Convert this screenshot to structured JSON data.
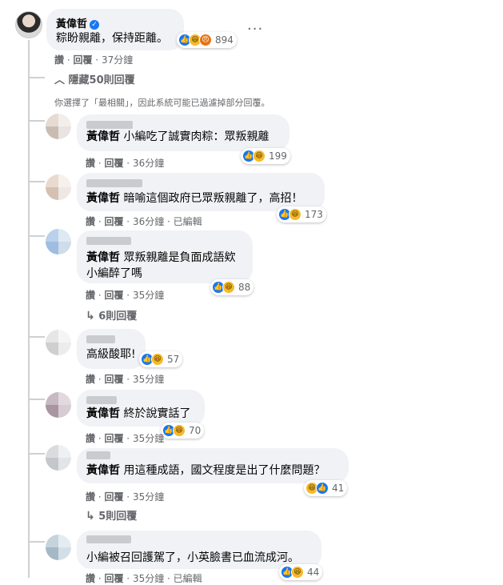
{
  "main_comment": {
    "author": "黃偉哲",
    "verified_icon": "verified-badge-icon",
    "text": "粽盼親離，保持距離。",
    "reaction_count": "894",
    "actions": {
      "like": "讚",
      "reply": "回覆",
      "time": "37分鐘"
    },
    "more_icon": "···"
  },
  "hide_replies_label": "隱藏50則回覆",
  "filter_notice": "你選擇了「最相關」，因此系統可能已過濾掉部分回覆。",
  "replies": [
    {
      "tag": "黃偉哲",
      "text": "小編吃了誠實肉粽：眾叛親離",
      "reaction_count": "199",
      "like": "讚",
      "reply": "回覆",
      "time": "36分鐘",
      "edited": ""
    },
    {
      "tag": "黃偉哲",
      "text": "暗喻這個政府已眾叛親離了，高招！",
      "reaction_count": "173",
      "like": "讚",
      "reply": "回覆",
      "time": "36分鐘",
      "edited": "已編輯"
    },
    {
      "tag": "黃偉哲",
      "text": "眾叛親離是負面成語欸",
      "text2": "小編醉了嗎",
      "reaction_count": "88",
      "like": "讚",
      "reply": "回覆",
      "time": "35分鐘",
      "edited": "",
      "sub_replies": "6則回覆"
    },
    {
      "tag": "",
      "text": "高級酸耶!",
      "reaction_count": "57",
      "like": "讚",
      "reply": "回覆",
      "time": "35分鐘",
      "edited": ""
    },
    {
      "tag": "黃偉哲",
      "text": "終於說實話了",
      "reaction_count": "70",
      "like": "讚",
      "reply": "回覆",
      "time": "35分鐘",
      "edited": ""
    },
    {
      "tag": "黃偉哲",
      "text": "用這種成語，國文程度是出了什麼問題？",
      "reaction_count": "41",
      "like": "讚",
      "reply": "回覆",
      "time": "35分鐘",
      "edited": "",
      "sub_replies": "5則回覆"
    },
    {
      "tag": "",
      "text": "小編被召回護駕了，小英臉書已血流成河。",
      "reaction_count": "44",
      "like": "讚",
      "reply": "回覆",
      "time": "35分鐘",
      "edited": "已編輯"
    }
  ],
  "colors": {
    "bubble": "#f0f2f5",
    "like": "#1877f2",
    "haha": "#f7b928",
    "angry": "#e9710f",
    "meta": "#65676b"
  }
}
